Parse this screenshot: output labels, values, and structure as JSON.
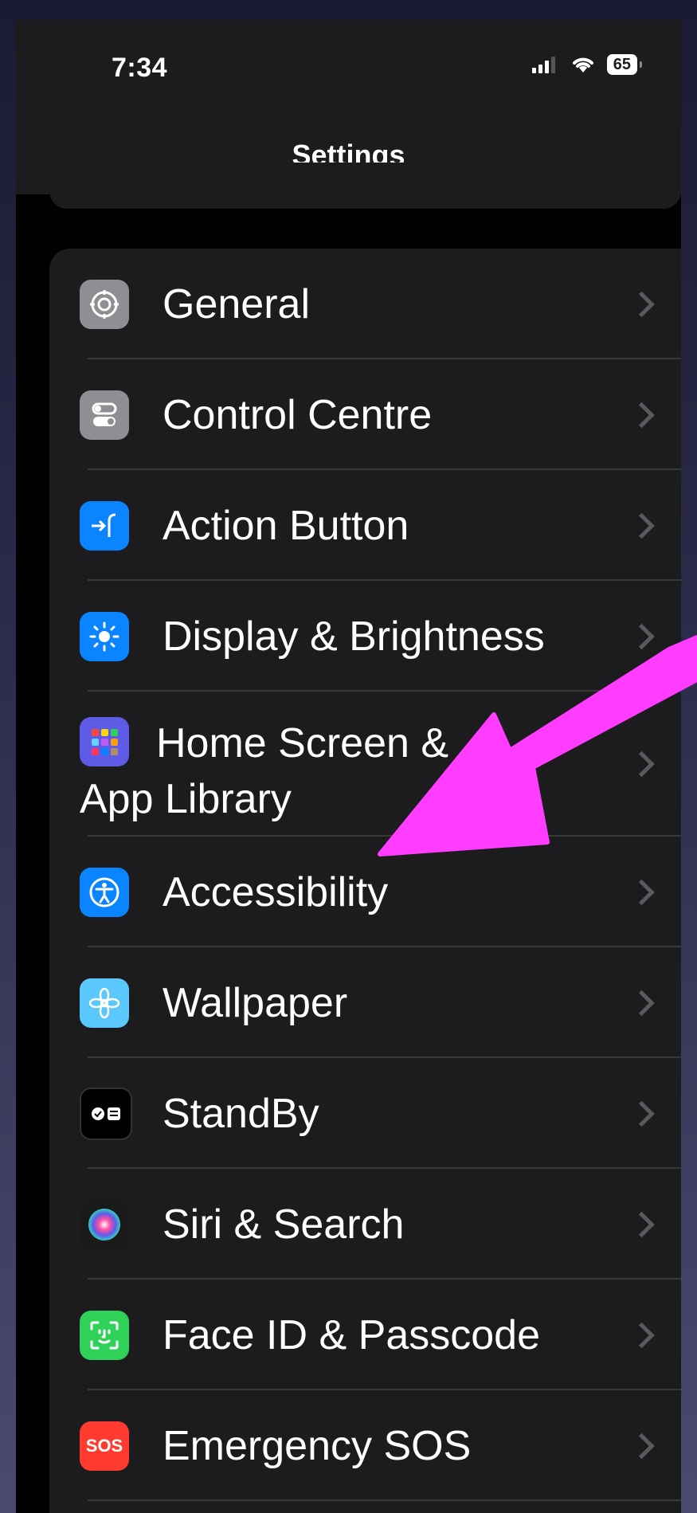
{
  "status_bar": {
    "time": "7:34",
    "battery": "65"
  },
  "nav": {
    "title": "Settings"
  },
  "settings": [
    {
      "label": "General",
      "icon": "gear-icon",
      "color": "#8e8e93"
    },
    {
      "label": "Control Centre",
      "icon": "toggles-icon",
      "color": "#8e8e93"
    },
    {
      "label": "Action Button",
      "icon": "action-button-icon",
      "color": "#0a84ff"
    },
    {
      "label": "Display & Brightness",
      "icon": "sun-icon",
      "color": "#0a84ff"
    },
    {
      "label": "Home Screen & App Library",
      "label_line1": "Home Screen &",
      "label_line2": "App Library",
      "icon": "app-grid-icon",
      "color": "#5e5ce6"
    },
    {
      "label": "Accessibility",
      "icon": "accessibility-icon",
      "color": "#0a84ff"
    },
    {
      "label": "Wallpaper",
      "icon": "flower-icon",
      "color": "#5ac8fa"
    },
    {
      "label": "StandBy",
      "icon": "standby-icon",
      "color": "#000000"
    },
    {
      "label": "Siri & Search",
      "icon": "siri-icon",
      "color": "#3a1f5c"
    },
    {
      "label": "Face ID & Passcode",
      "icon": "face-id-icon",
      "color": "#30d158"
    },
    {
      "label": "Emergency SOS",
      "icon": "sos-icon",
      "icon_text": "SOS",
      "color": "#ff3b30"
    }
  ],
  "annotation": {
    "color": "#ff3cff",
    "points_to": "Accessibility"
  }
}
